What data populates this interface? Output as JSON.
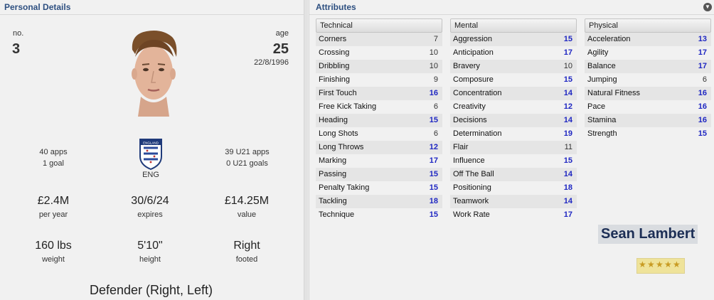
{
  "personal": {
    "title": "Personal Details",
    "no_label": "no.",
    "no_value": "3",
    "age_label": "age",
    "age_value": "25",
    "dob": "22/8/1996",
    "apps": "40 apps",
    "goals": "1 goal",
    "nation": "ENG",
    "u21_apps": "39 U21 apps",
    "u21_goals": "0 U21 goals",
    "wage": "£2.4M",
    "wage_label": "per year",
    "expires": "30/6/24",
    "expires_label": "expires",
    "value": "£14.25M",
    "value_label": "value",
    "weight": "160 lbs",
    "weight_label": "weight",
    "height": "5'10\"",
    "height_label": "height",
    "foot": "Right",
    "foot_label": "footed",
    "position": "Defender (Right, Left)",
    "crest_text": "ENGLAND"
  },
  "attributes": {
    "title": "Attributes",
    "colors": {
      "high": "#1f27c2",
      "normal": "#333333"
    },
    "technical": {
      "heading": "Technical",
      "rows": [
        {
          "name": "Corners",
          "value": "7"
        },
        {
          "name": "Crossing",
          "value": "10"
        },
        {
          "name": "Dribbling",
          "value": "10"
        },
        {
          "name": "Finishing",
          "value": "9"
        },
        {
          "name": "First Touch",
          "value": "16"
        },
        {
          "name": "Free Kick Taking",
          "value": "6"
        },
        {
          "name": "Heading",
          "value": "15"
        },
        {
          "name": "Long Shots",
          "value": "6"
        },
        {
          "name": "Long Throws",
          "value": "12"
        },
        {
          "name": "Marking",
          "value": "17"
        },
        {
          "name": "Passing",
          "value": "15"
        },
        {
          "name": "Penalty Taking",
          "value": "15"
        },
        {
          "name": "Tackling",
          "value": "18"
        },
        {
          "name": "Technique",
          "value": "15"
        }
      ]
    },
    "mental": {
      "heading": "Mental",
      "rows": [
        {
          "name": "Aggression",
          "value": "15"
        },
        {
          "name": "Anticipation",
          "value": "17"
        },
        {
          "name": "Bravery",
          "value": "10"
        },
        {
          "name": "Composure",
          "value": "15"
        },
        {
          "name": "Concentration",
          "value": "14"
        },
        {
          "name": "Creativity",
          "value": "12"
        },
        {
          "name": "Decisions",
          "value": "14"
        },
        {
          "name": "Determination",
          "value": "19"
        },
        {
          "name": "Flair",
          "value": "11"
        },
        {
          "name": "Influence",
          "value": "15"
        },
        {
          "name": "Off The Ball",
          "value": "14"
        },
        {
          "name": "Positioning",
          "value": "18"
        },
        {
          "name": "Teamwork",
          "value": "14"
        },
        {
          "name": "Work Rate",
          "value": "17"
        }
      ]
    },
    "physical": {
      "heading": "Physical",
      "rows": [
        {
          "name": "Acceleration",
          "value": "13"
        },
        {
          "name": "Agility",
          "value": "17"
        },
        {
          "name": "Balance",
          "value": "17"
        },
        {
          "name": "Jumping",
          "value": "6"
        },
        {
          "name": "Natural Fitness",
          "value": "16"
        },
        {
          "name": "Pace",
          "value": "16"
        },
        {
          "name": "Stamina",
          "value": "16"
        },
        {
          "name": "Strength",
          "value": "15"
        }
      ]
    }
  },
  "player": {
    "name": "Sean Lambert",
    "star_rating": 5,
    "star_max": 5
  },
  "icons": [
    "collapse-icon",
    "player-face-icon",
    "england-crest-icon",
    "star-icon"
  ]
}
